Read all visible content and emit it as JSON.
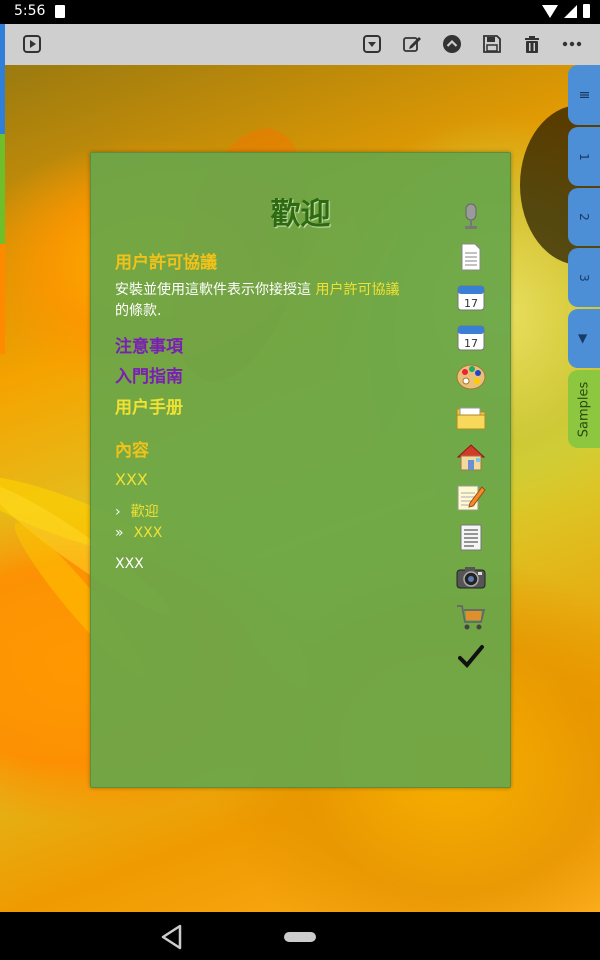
{
  "status": {
    "time": "5:56"
  },
  "toolbar": {
    "icons": [
      "play-box-icon",
      "dropdown-box-icon",
      "edit-icon",
      "chevron-up-circle-icon",
      "save-icon",
      "trash-icon",
      "more-icon"
    ]
  },
  "side_tabs": {
    "menu": "Ⅲ",
    "tab1": "1",
    "tab2": "2",
    "tab3": "3",
    "play": "▶",
    "samples": "Samples"
  },
  "panel": {
    "title": "歡迎",
    "license_heading": "用户許可協議",
    "para_prefix": "安裝並使用這軟件表示你接授這",
    "para_link": "用户許可協議",
    "para_suffix": "的條款.",
    "notes": "注意事項",
    "getting_started": "入門指南",
    "manual": "用户手册",
    "contents": "內容",
    "xxx_heading": "XXX",
    "crumb1_arrow": "›",
    "crumb1": "歡迎",
    "crumb2_arrow": "»",
    "crumb2": "XXX",
    "footer": "XXX"
  },
  "colors": {
    "panel": "#68a64a",
    "title": "#2d6a12",
    "heading_yellow": "#f1c21a",
    "heading_purple": "#7a1fb3",
    "link_yellow": "#f1e133",
    "tab_blue": "#4c8fd6",
    "tab_green": "#8dc63f"
  },
  "icons_column": [
    "microphone-icon",
    "document-icon",
    "calendar-icon",
    "calendar-icon",
    "palette-icon",
    "folder-icon",
    "home-icon",
    "notepad-icon",
    "text-file-icon",
    "camera-icon",
    "shopping-cart-icon",
    "checkmark-icon"
  ]
}
